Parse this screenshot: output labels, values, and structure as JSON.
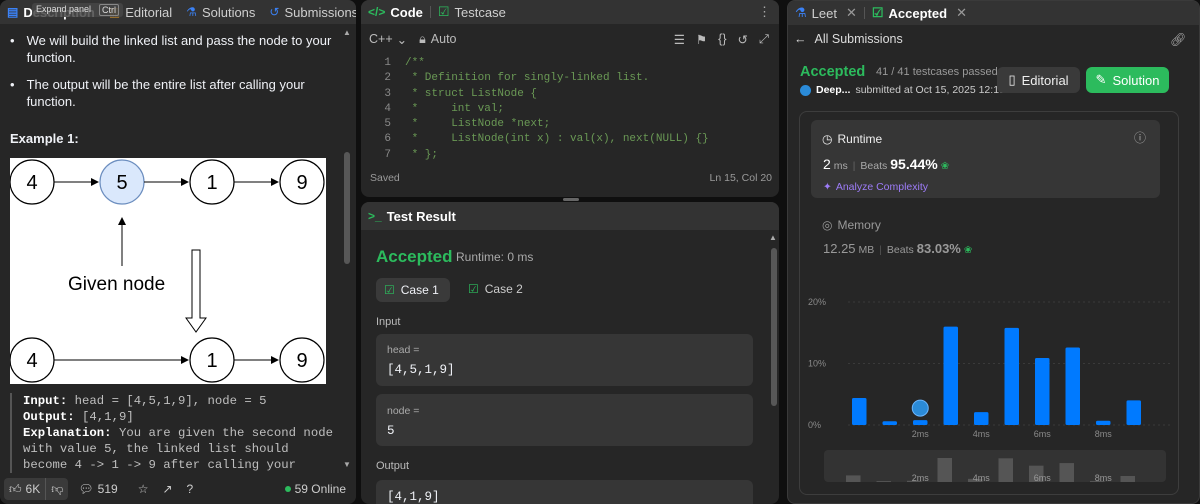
{
  "left": {
    "tabs": [
      {
        "label": "Description",
        "icon": "document-icon"
      },
      {
        "label": "Editorial",
        "icon": "book-icon"
      },
      {
        "label": "Solutions",
        "icon": "flask-icon"
      },
      {
        "label": "Submissions",
        "icon": "history-icon"
      }
    ],
    "tooltip": {
      "text": "Expand panel",
      "shortcut": "Ctrl"
    },
    "bullets": [
      "We will build the linked list and pass the node to your function.",
      "The output will be the entire list after calling your function."
    ],
    "example_title": "Example 1:",
    "diagram": {
      "top_nodes": [
        "4",
        "5",
        "1",
        "9"
      ],
      "bottom_nodes": [
        "4",
        "1",
        "9"
      ],
      "given_label": "Given node"
    },
    "example_text": {
      "input_label": "Input:",
      "input_value": "head = [4,5,1,9], node = 5",
      "output_label": "Output:",
      "output_value": "[4,1,9]",
      "explanation_label": "Explanation:",
      "explanation_value": "You are given the second node with value 5, the linked list should become 4 -> 1 -> 9 after calling your function."
    },
    "footer": {
      "likes": "6K",
      "comments": "519",
      "online": "59 Online"
    }
  },
  "code": {
    "title": "Code",
    "testcase": "Testcase",
    "language": "C++",
    "mode": "Auto",
    "lines": [
      {
        "n": "1",
        "t": "/**"
      },
      {
        "n": "2",
        "t": " * Definition for singly-linked list."
      },
      {
        "n": "3",
        "t": " * struct ListNode {"
      },
      {
        "n": "4",
        "t": " *     int val;"
      },
      {
        "n": "5",
        "t": " *     ListNode *next;"
      },
      {
        "n": "6",
        "t": " *     ListNode(int x) : val(x), next(NULL) {}"
      },
      {
        "n": "7",
        "t": " * };"
      }
    ],
    "status": "Saved",
    "cursor": "Ln 15, Col 20"
  },
  "result": {
    "title": "Test Result",
    "verdict": "Accepted",
    "runtime": "Runtime: 0 ms",
    "cases": [
      "Case 1",
      "Case 2"
    ],
    "input_label": "Input",
    "head_label": "head =",
    "head_value": "[4,5,1,9]",
    "node_label": "node =",
    "node_value": "5",
    "output_label": "Output",
    "output_value": "[4,1,9]"
  },
  "right": {
    "tabs": [
      {
        "label": "Leet",
        "icon": "flask-icon"
      },
      {
        "label": "Accepted",
        "icon": "check-icon"
      }
    ],
    "back_label": "All Submissions",
    "verdict": "Accepted",
    "passed": "41 / 41 testcases passed",
    "user": "Deep...",
    "submitted": "submitted at Oct 15, 2025 12:13",
    "editorial_btn": "Editorial",
    "solution_btn": "Solution",
    "runtime": {
      "label": "Runtime",
      "value": "2",
      "unit": "ms",
      "beats_label": "Beats",
      "beats": "95.44%",
      "analyze": "Analyze Complexity"
    },
    "memory": {
      "label": "Memory",
      "value": "12.25",
      "unit": "MB",
      "beats_label": "Beats",
      "beats": "83.03%"
    }
  },
  "colors": {
    "accent_green": "#2cbb5d",
    "blue": "#007aff",
    "bg": "#0f0f0f",
    "panel": "#262626"
  },
  "chart_data": {
    "type": "bar",
    "yticks": [
      "20%",
      "10%",
      "0%"
    ],
    "xticks": [
      "2ms",
      "4ms",
      "6ms",
      "8ms"
    ],
    "ylim": [
      0,
      20
    ],
    "values": [
      4.4,
      0.6,
      0.8,
      16,
      2.1,
      15.8,
      10.9,
      12.6,
      0.7,
      4
    ]
  }
}
